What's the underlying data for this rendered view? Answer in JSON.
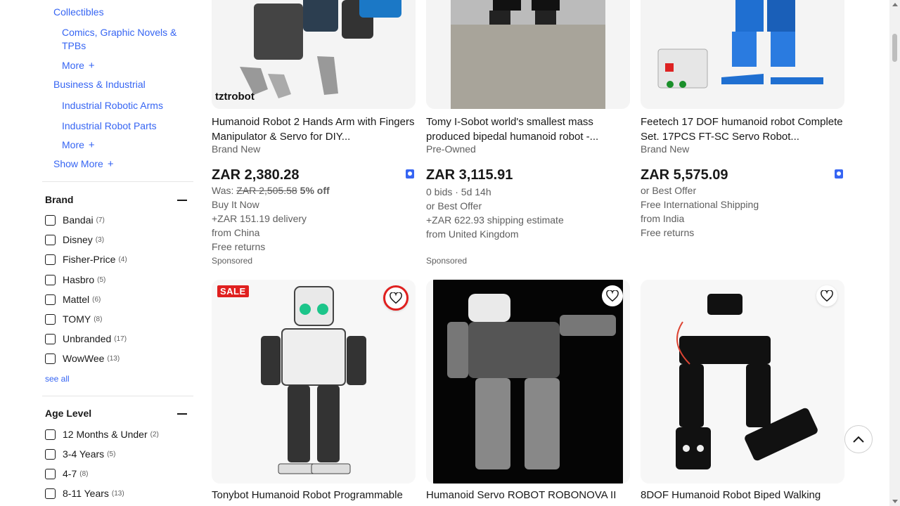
{
  "sidebar": {
    "categories": [
      {
        "label": "Collectibles"
      },
      {
        "label": "Comics, Graphic Novels &"
      },
      {
        "label": "TPBs"
      },
      {
        "label": "More"
      },
      {
        "label": "Business & Industrial"
      },
      {
        "label": "Industrial Robotic Arms"
      },
      {
        "label": "Industrial Robot Parts"
      },
      {
        "label": "More"
      },
      {
        "label": "Show More"
      }
    ],
    "brand": {
      "title": "Brand",
      "options": [
        {
          "label": "Bandai",
          "count": "(7)"
        },
        {
          "label": "Disney",
          "count": "(3)"
        },
        {
          "label": "Fisher-Price",
          "count": "(4)"
        },
        {
          "label": "Hasbro",
          "count": "(5)"
        },
        {
          "label": "Mattel",
          "count": "(6)"
        },
        {
          "label": "TOMY",
          "count": "(8)"
        },
        {
          "label": "Unbranded",
          "count": "(17)"
        },
        {
          "label": "WowWee",
          "count": "(13)"
        }
      ],
      "see_all": "see all"
    },
    "age": {
      "title": "Age Level",
      "options": [
        {
          "label": "12 Months & Under",
          "count": "(2)"
        },
        {
          "label": "3-4 Years",
          "count": "(5)"
        },
        {
          "label": "4-7",
          "count": "(8)"
        },
        {
          "label": "8-11 Years",
          "count": "(13)"
        }
      ]
    }
  },
  "items": [
    {
      "title": "Humanoid Robot 2 Hands Arm with Fingers Manipulator & Servo for DIY...",
      "condition": "Brand New",
      "price": "ZAR 2,380.28",
      "was_label": "Was:",
      "was_price": "ZAR 2,505.58",
      "off": "5% off",
      "buy": "Buy It Now",
      "delivery": "+ZAR 151.19 delivery",
      "from": "from China",
      "returns": "Free returns",
      "sponsored": "Sponsored",
      "brand_watermark": "tztrobot"
    },
    {
      "title": "Tomy I-Sobot world's smallest mass produced bipedal humanoid robot -...",
      "condition": "Pre-Owned",
      "price": "ZAR 3,115.91",
      "bids": "0 bids · 5d 14h",
      "offer": "or Best Offer",
      "shipping": "+ZAR 622.93 shipping estimate",
      "from": "from United Kingdom",
      "sponsored": "Sponsored"
    },
    {
      "title": "Feetech 17 DOF humanoid robot Complete Set. 17PCS FT-SC Servo Robot...",
      "condition": "Brand New",
      "price": "ZAR 5,575.09",
      "offer": "or Best Offer",
      "shipping": "Free International Shipping",
      "from": "from India",
      "returns": "Free returns"
    },
    {
      "title": "Tonybot Humanoid Robot Programmable",
      "sale": "SALE"
    },
    {
      "title": "Humanoid Servo ROBOT ROBONOVA II"
    },
    {
      "title": "8DOF Humanoid Robot Biped Walking"
    }
  ],
  "colors": {
    "link": "#3665f3",
    "text": "#191919",
    "secondary": "#5e5e5e",
    "sale": "#e0201f"
  }
}
